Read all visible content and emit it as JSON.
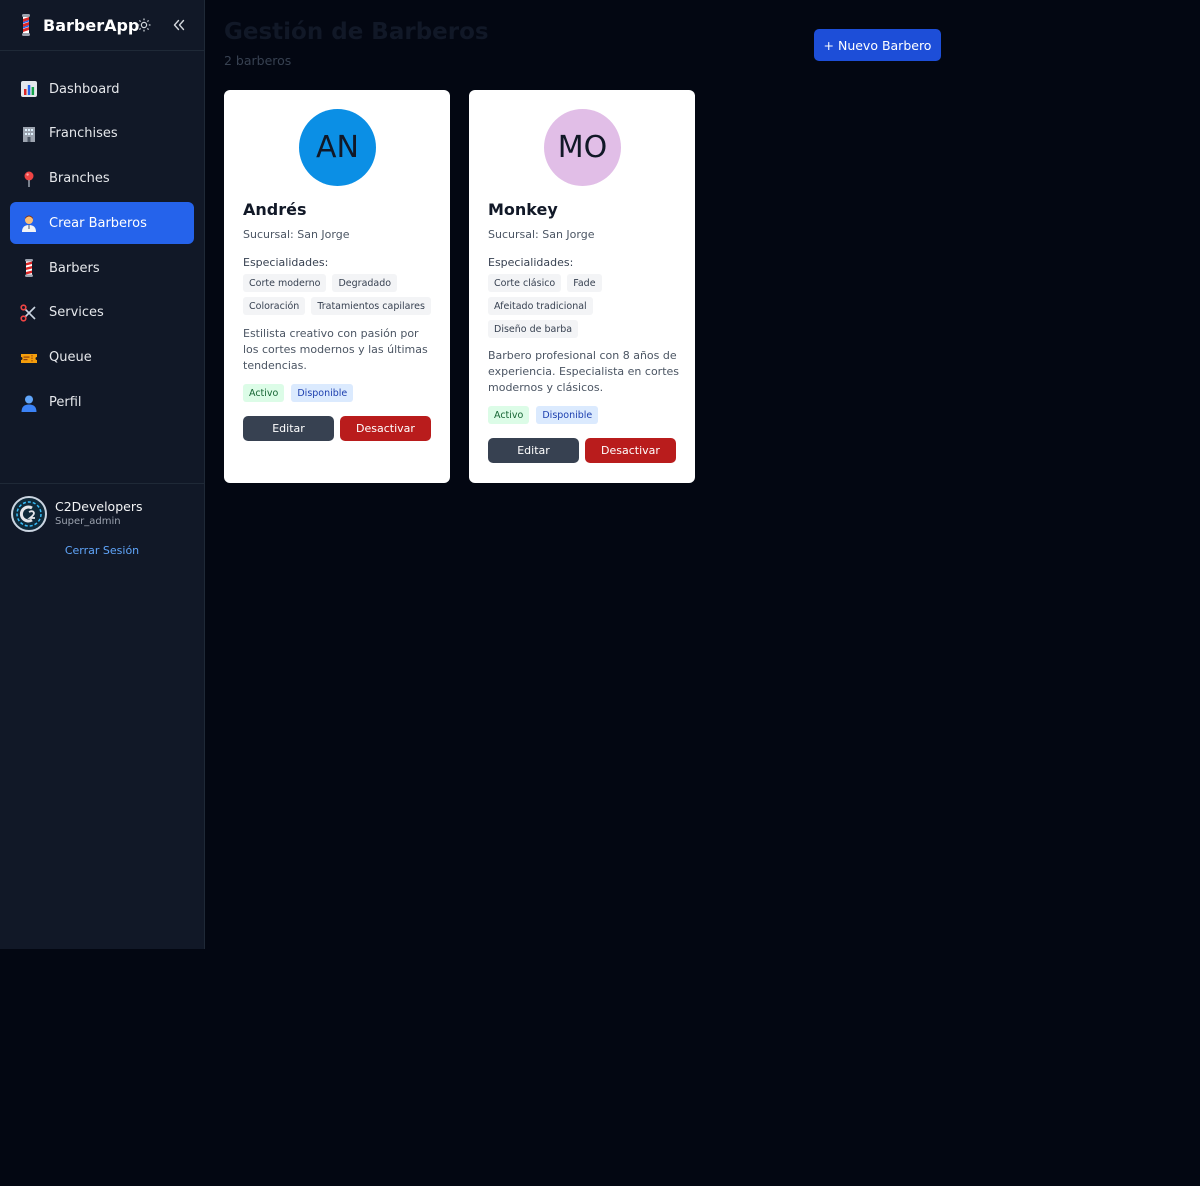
{
  "app": {
    "title": "BarberApp",
    "logo_icon": "barber-pole-icon",
    "theme_icon": "sun-icon",
    "collapse_icon": "chevrons-left-icon"
  },
  "sidebar": {
    "items": [
      {
        "label": "Dashboard",
        "icon": "bar-chart-icon",
        "active": false
      },
      {
        "label": "Franchises",
        "icon": "office-building-icon",
        "active": false
      },
      {
        "label": "Branches",
        "icon": "map-pin-icon",
        "active": false
      },
      {
        "label": "Crear Barberos",
        "icon": "barber-person-icon",
        "active": true
      },
      {
        "label": "Barbers",
        "icon": "barber-pole-icon",
        "active": false
      },
      {
        "label": "Services",
        "icon": "scissors-icon",
        "active": false
      },
      {
        "label": "Queue",
        "icon": "ticket-icon",
        "active": false
      },
      {
        "label": "Perfil",
        "icon": "user-icon",
        "active": false
      }
    ]
  },
  "user": {
    "name": "C2Developers",
    "role": "Super_admin",
    "logout_label": "Cerrar Sesión"
  },
  "header": {
    "title": "Gestión de Barberos",
    "subtitle": "2 barberos",
    "new_button_label": "+ Nuevo Barbero"
  },
  "colors": {
    "accent": "#2563eb",
    "danger": "#b91c1c",
    "sidebar_bg": "#111827",
    "page_bg": "#030712"
  },
  "barbers": [
    {
      "initials": "AN",
      "avatar_color": "#0b8fe5",
      "name": "Andrés",
      "branch": "Sucursal: San Jorge",
      "specialties_label": "Especialidades:",
      "specialties": [
        "Corte moderno",
        "Degradado",
        "Coloración",
        "Tratamientos capilares"
      ],
      "description": "Estilista creativo con pasión por los cortes modernos y las últimas tendencias.",
      "status": "Activo",
      "availability": "Disponible",
      "edit_label": "Editar",
      "deactivate_label": "Desactivar"
    },
    {
      "initials": "MO",
      "avatar_color": "#e1bee7",
      "name": "Monkey",
      "branch": "Sucursal: San Jorge",
      "specialties_label": "Especialidades:",
      "specialties": [
        "Corte clásico",
        "Fade",
        "Afeitado tradicional",
        "Diseño de barba"
      ],
      "description": "Barbero profesional con 8 años de experiencia. Especialista en cortes modernos y clásicos.",
      "status": "Activo",
      "availability": "Disponible",
      "edit_label": "Editar",
      "deactivate_label": "Desactivar"
    }
  ]
}
